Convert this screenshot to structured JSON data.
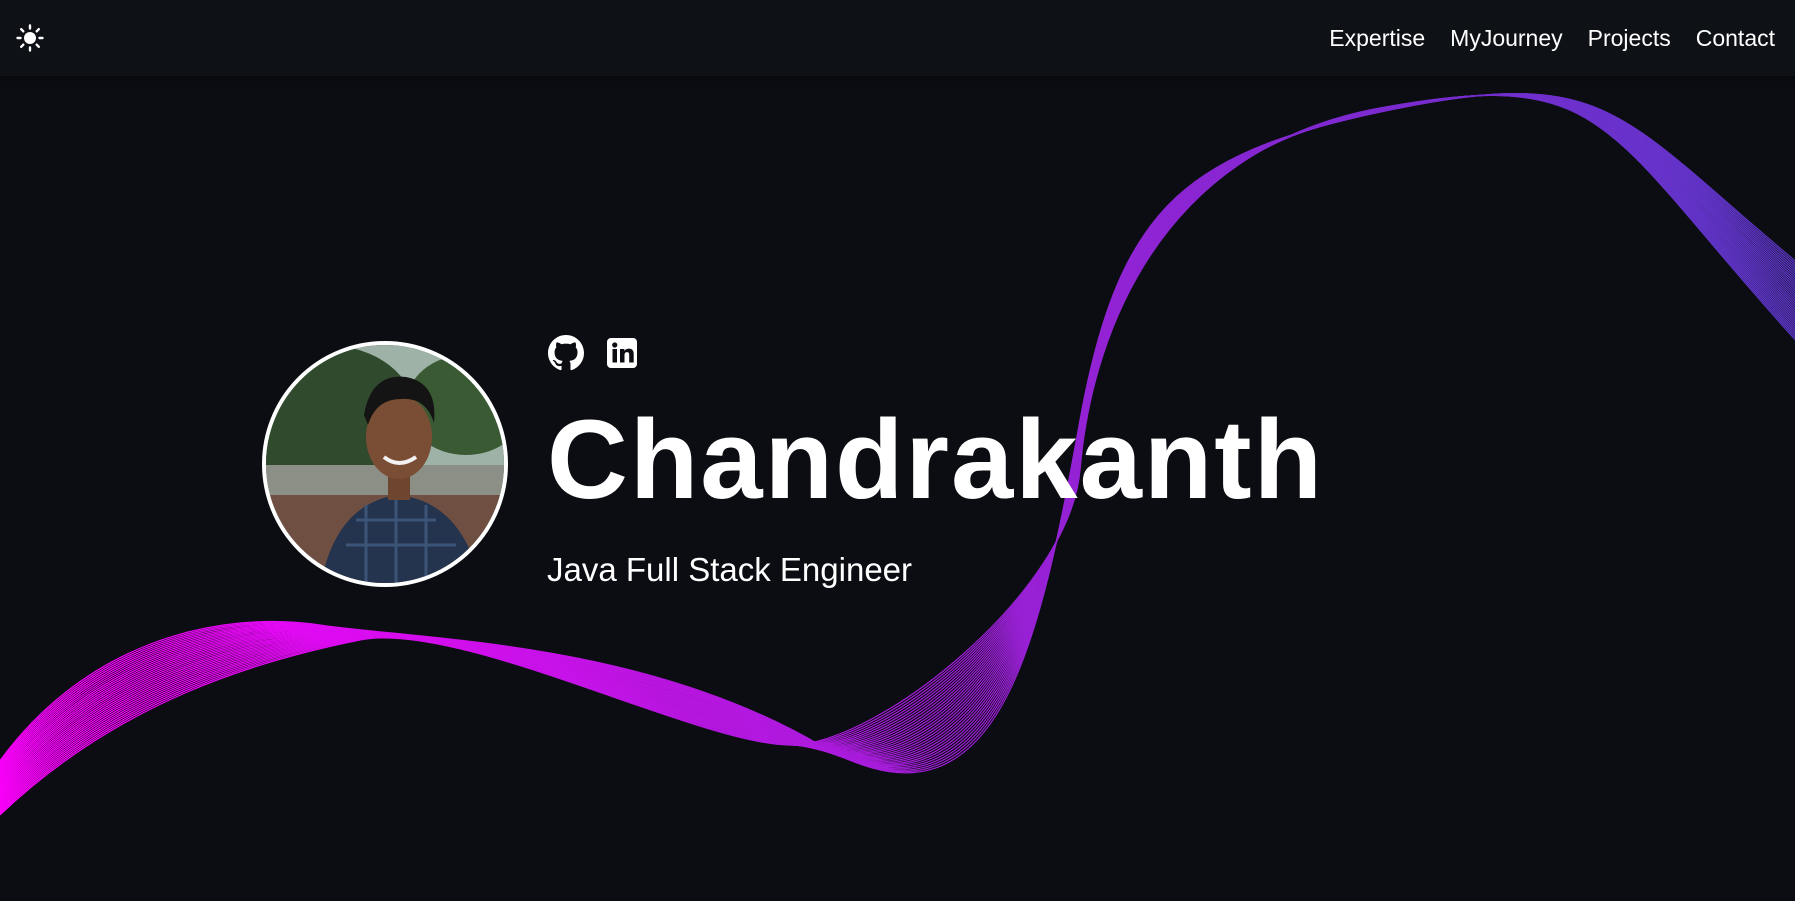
{
  "nav": {
    "theme_icon": "sun-icon",
    "links": [
      {
        "label": "Expertise"
      },
      {
        "label": "MyJourney"
      },
      {
        "label": "Projects"
      },
      {
        "label": "Contact"
      }
    ]
  },
  "hero": {
    "socials": [
      {
        "icon": "github-icon"
      },
      {
        "icon": "linkedin-icon"
      }
    ],
    "name": "Chandrakanth",
    "role": "Java Full Stack Engineer"
  },
  "colors": {
    "background": "#0b0d12",
    "navbar": "#0e1116",
    "wave_start": "#ff00ff",
    "wave_mid": "#9b1fd6",
    "wave_end": "#5b36c8"
  }
}
